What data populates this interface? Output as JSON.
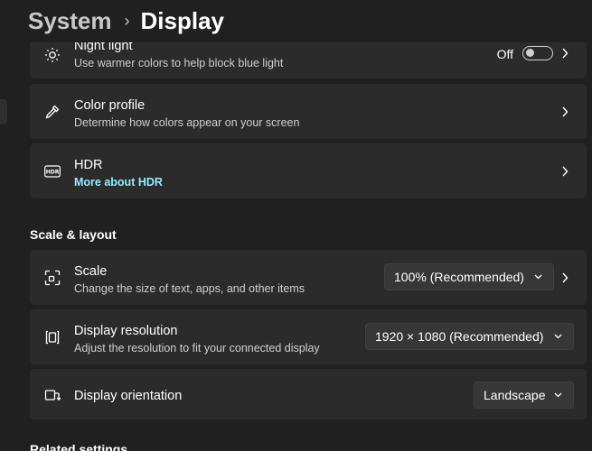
{
  "header": {
    "parent": "System",
    "separator": "›",
    "current": "Display"
  },
  "brightness_color": {
    "night_light": {
      "title": "Night light",
      "description": "Use warmer colors to help block blue light",
      "toggle_label": "Off",
      "toggle_on": false,
      "icon": "sun-icon"
    },
    "color_profile": {
      "title": "Color profile",
      "description": "Determine how colors appear on your screen",
      "icon": "eyedropper-icon"
    },
    "hdr": {
      "title": "HDR",
      "link": "More about HDR",
      "icon": "hdr-icon"
    }
  },
  "scale_layout": {
    "section_title": "Scale & layout",
    "scale": {
      "title": "Scale",
      "description": "Change the size of text, apps, and other items",
      "value": "100% (Recommended)",
      "icon": "scale-icon"
    },
    "resolution": {
      "title": "Display resolution",
      "description": "Adjust the resolution to fit your connected display",
      "value": "1920 × 1080 (Recommended)",
      "icon": "resolution-icon"
    },
    "orientation": {
      "title": "Display orientation",
      "value": "Landscape",
      "icon": "orientation-icon"
    }
  },
  "next_section_peek": "Related settings",
  "colors": {
    "background": "#202020",
    "card": "#2b2b2b",
    "link": "#99ebff"
  }
}
